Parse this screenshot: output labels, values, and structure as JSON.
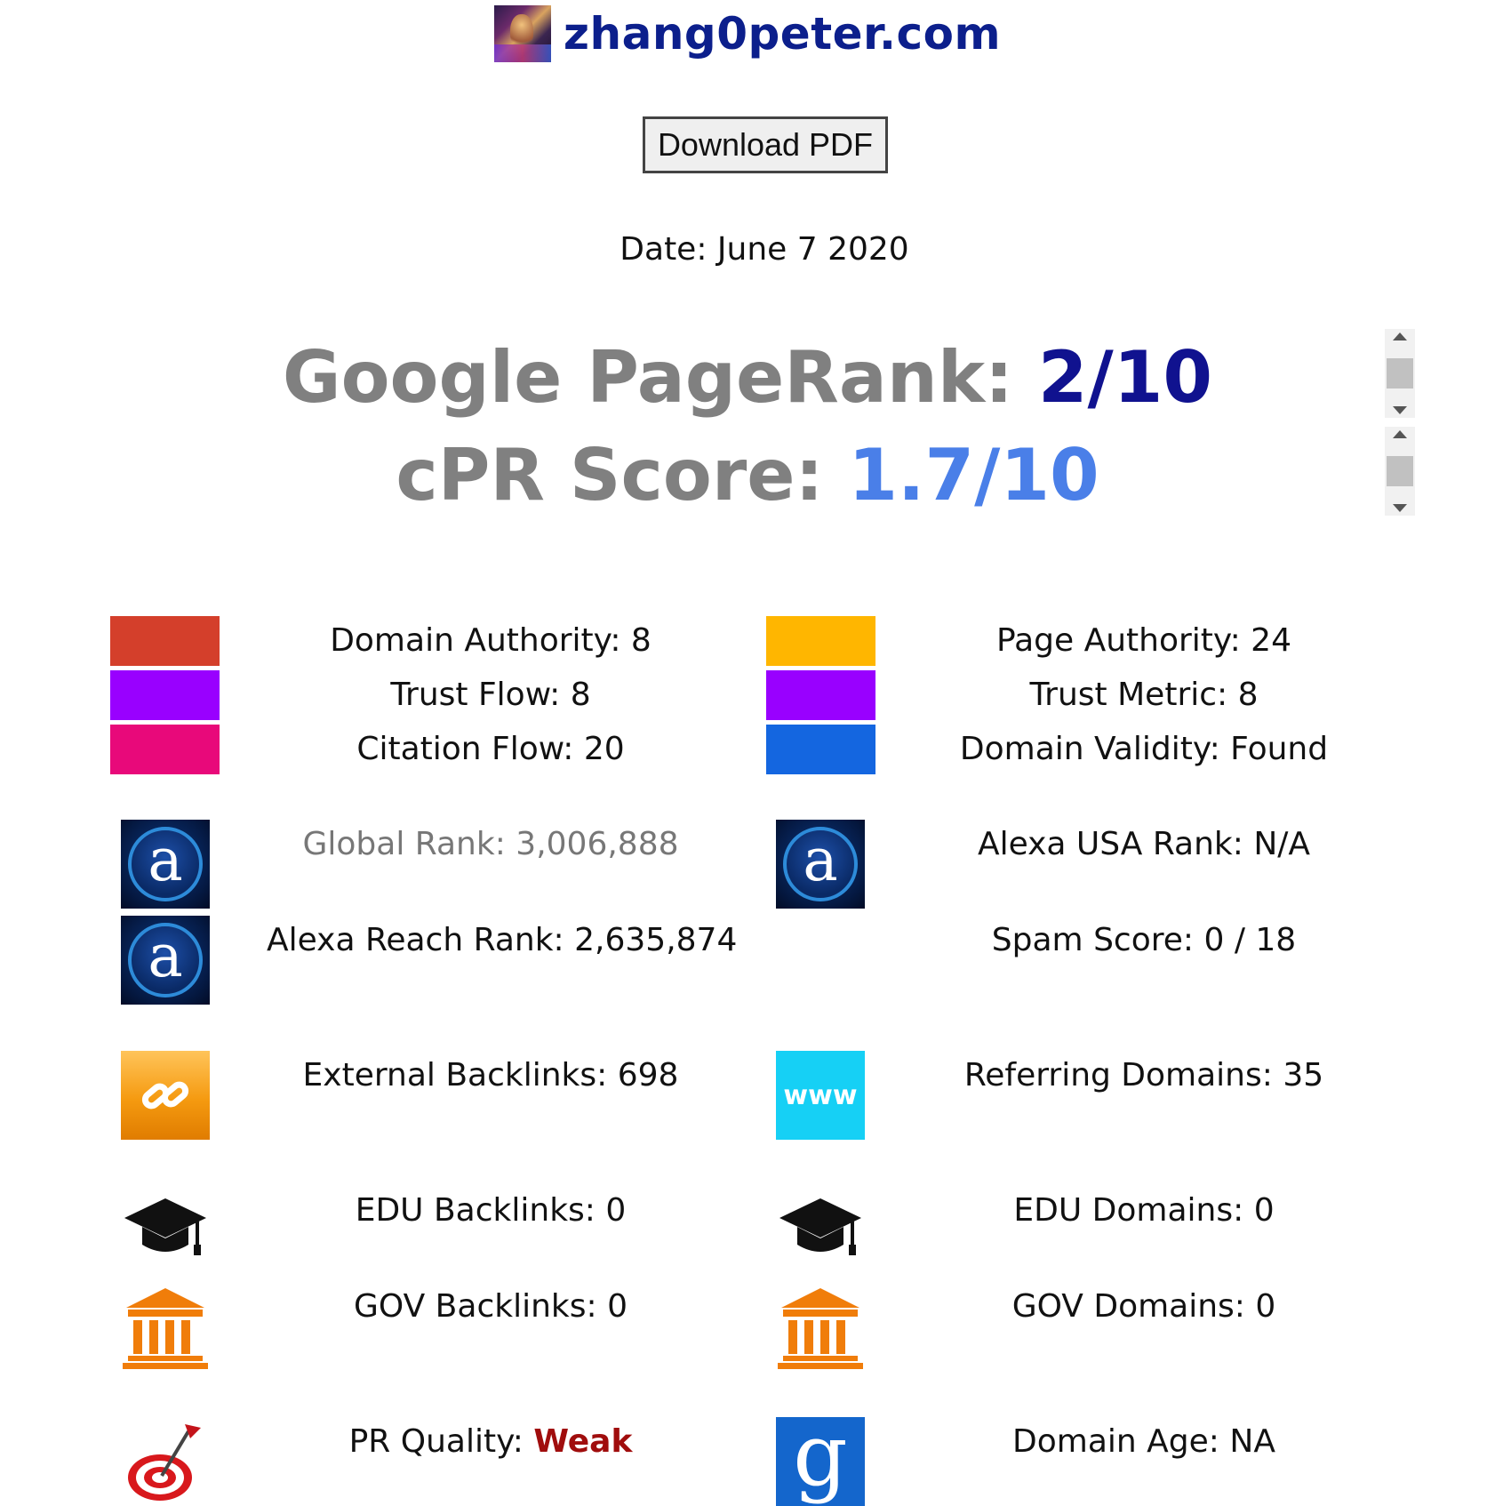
{
  "header": {
    "site_title": "zhang0peter.com",
    "favicon_icon": "site-favicon-icon"
  },
  "toolbar": {
    "download_label": "Download PDF"
  },
  "report": {
    "date_text": "Date: June 7 2020"
  },
  "scores": {
    "pagerank_label": "Google PageRank: ",
    "pagerank_value": "2/10",
    "cpr_label": "cPR Score: ",
    "cpr_value": "1.7/10"
  },
  "colors": {
    "domain_authority": "#d43f2b",
    "trust_flow": "#9900ff",
    "citation_flow": "#e8097a",
    "page_authority": "#ffb600",
    "trust_metric": "#9900ff",
    "domain_validity": "#1466e0",
    "pagerank_value": "#10128f",
    "cpr_value": "#4a7fe8",
    "weak": "#a00d0d"
  },
  "metrics": {
    "domain_authority": "Domain Authority: 8",
    "trust_flow": "Trust Flow: 8",
    "citation_flow": "Citation Flow: 20",
    "page_authority": "Page Authority: 24",
    "trust_metric": "Trust Metric: 8",
    "domain_validity": "Domain Validity: Found",
    "global_rank": "Global Rank: 3,006,888",
    "alexa_usa_rank": "Alexa USA Rank: N/A",
    "alexa_reach_rank": "Alexa Reach Rank: 2,635,874",
    "spam_score": "Spam Score: 0 / 18",
    "external_backlinks": "External Backlinks: 698",
    "referring_domains": "Referring Domains: 35",
    "edu_backlinks": "EDU Backlinks: 0",
    "edu_domains": "EDU Domains: 0",
    "gov_backlinks": "GOV Backlinks: 0",
    "gov_domains": "GOV Domains: 0",
    "pr_quality_label": "PR Quality: ",
    "pr_quality_value": "Weak",
    "domain_age": "Domain Age: NA"
  },
  "icons": {
    "alexa": "a",
    "www": "www",
    "google": "g"
  }
}
